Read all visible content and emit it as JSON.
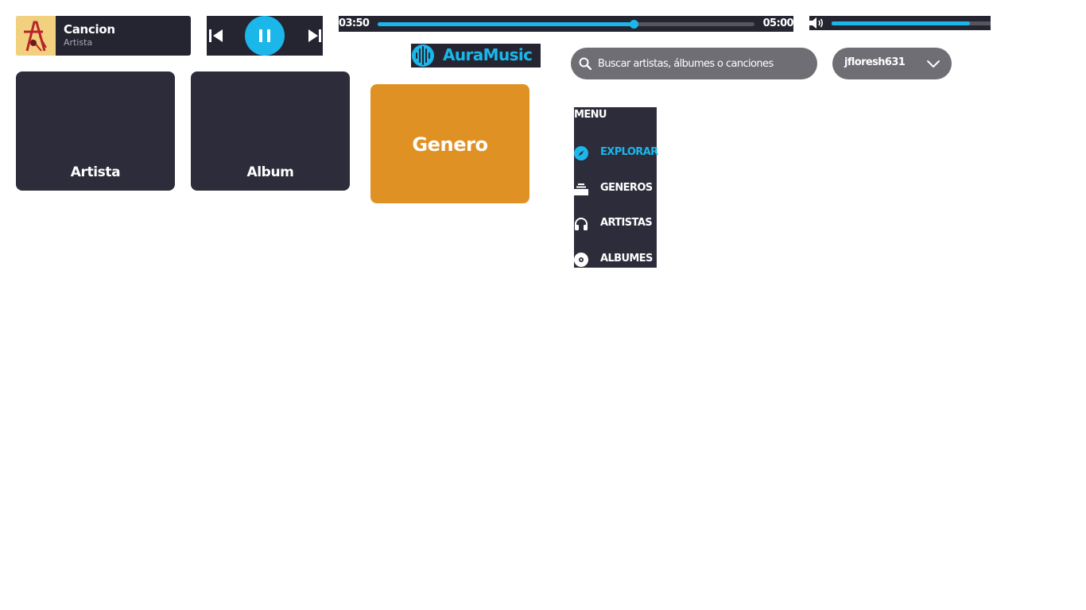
{
  "now_playing": {
    "title": "Cancion",
    "artist": "Artista"
  },
  "player": {
    "current_time": "03:50",
    "total_time": "05:00",
    "progress": 0.68,
    "volume": 0.87,
    "state": "playing"
  },
  "logo": {
    "text": "AuraMusic"
  },
  "search": {
    "placeholder": "Buscar artistas, álbumes o canciones"
  },
  "user": {
    "name": "jfloresh631"
  },
  "cards": [
    {
      "label": "Artista"
    },
    {
      "label": "Album"
    },
    {
      "label": "Genero"
    }
  ],
  "menu": {
    "title": "MENU",
    "items": [
      {
        "label": "EXPLORAR",
        "icon": "compass-icon",
        "active": true
      },
      {
        "label": "GENEROS",
        "icon": "stack-icon",
        "active": false
      },
      {
        "label": "ARTISTAS",
        "icon": "headphones-icon",
        "active": false
      },
      {
        "label": "ALBUMES",
        "icon": "disc-icon",
        "active": false
      }
    ]
  },
  "colors": {
    "accent": "#1bb6ea",
    "panel": "#252531",
    "card": "#2c2c3b",
    "genero_card": "#e09123",
    "pill": "#6e6e74"
  }
}
